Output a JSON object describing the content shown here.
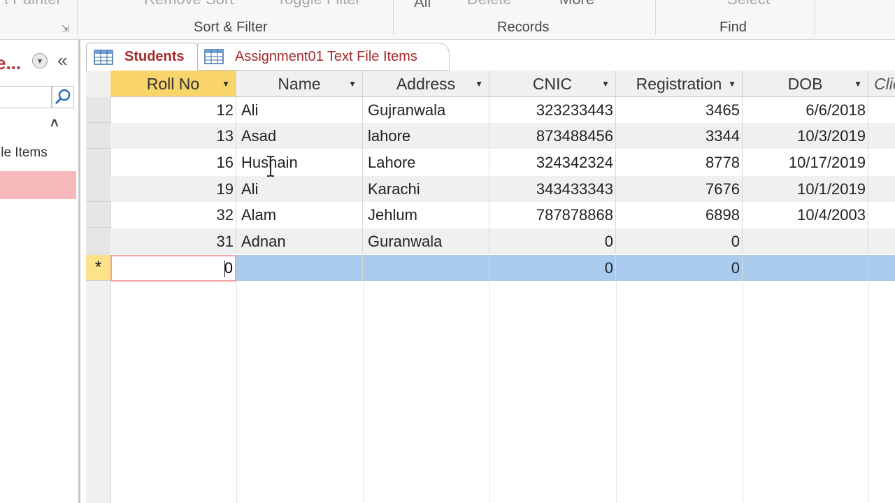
{
  "ribbon": {
    "top_row": [
      "t Painter",
      "Remove Sort",
      "Toggle Filter",
      "All",
      "Delete",
      "More",
      "Select"
    ],
    "groups": [
      "Sort & Filter",
      "Records",
      "Find"
    ]
  },
  "nav": {
    "title": "e...",
    "item": "ile Items"
  },
  "tabs": [
    {
      "label": "Students",
      "active": true
    },
    {
      "label": "Assignment01 Text File Items",
      "active": false
    }
  ],
  "table": {
    "columns": [
      "Roll No",
      "Name",
      "Address",
      "CNIC",
      "Registration",
      "DOB",
      "Clic"
    ],
    "rows": [
      [
        "12",
        "Ali",
        "Gujranwala",
        "323233443",
        "3465",
        "6/6/2018"
      ],
      [
        "13",
        "Asad",
        "lahore",
        "873488456",
        "3344",
        "10/3/2019"
      ],
      [
        "16",
        "Husnain",
        "Lahore",
        "324342324",
        "8778",
        "10/17/2019"
      ],
      [
        "19",
        "Ali",
        "Karachi",
        "343433343",
        "7676",
        "10/1/2019"
      ],
      [
        "32",
        "Alam",
        "Jehlum",
        "787878868",
        "6898",
        "10/4/2003"
      ],
      [
        "31",
        "Adnan",
        "Guranwala",
        "0",
        "0",
        ""
      ]
    ],
    "new_row": {
      "marker": "*",
      "roll_no": "0",
      "cnic": "0",
      "registration": "0"
    }
  },
  "colors": {
    "accent": "#a52a2a",
    "active_header": "#f9d46a",
    "new_row": "#a9ccee",
    "nav_selected": "#f7b8bb"
  }
}
